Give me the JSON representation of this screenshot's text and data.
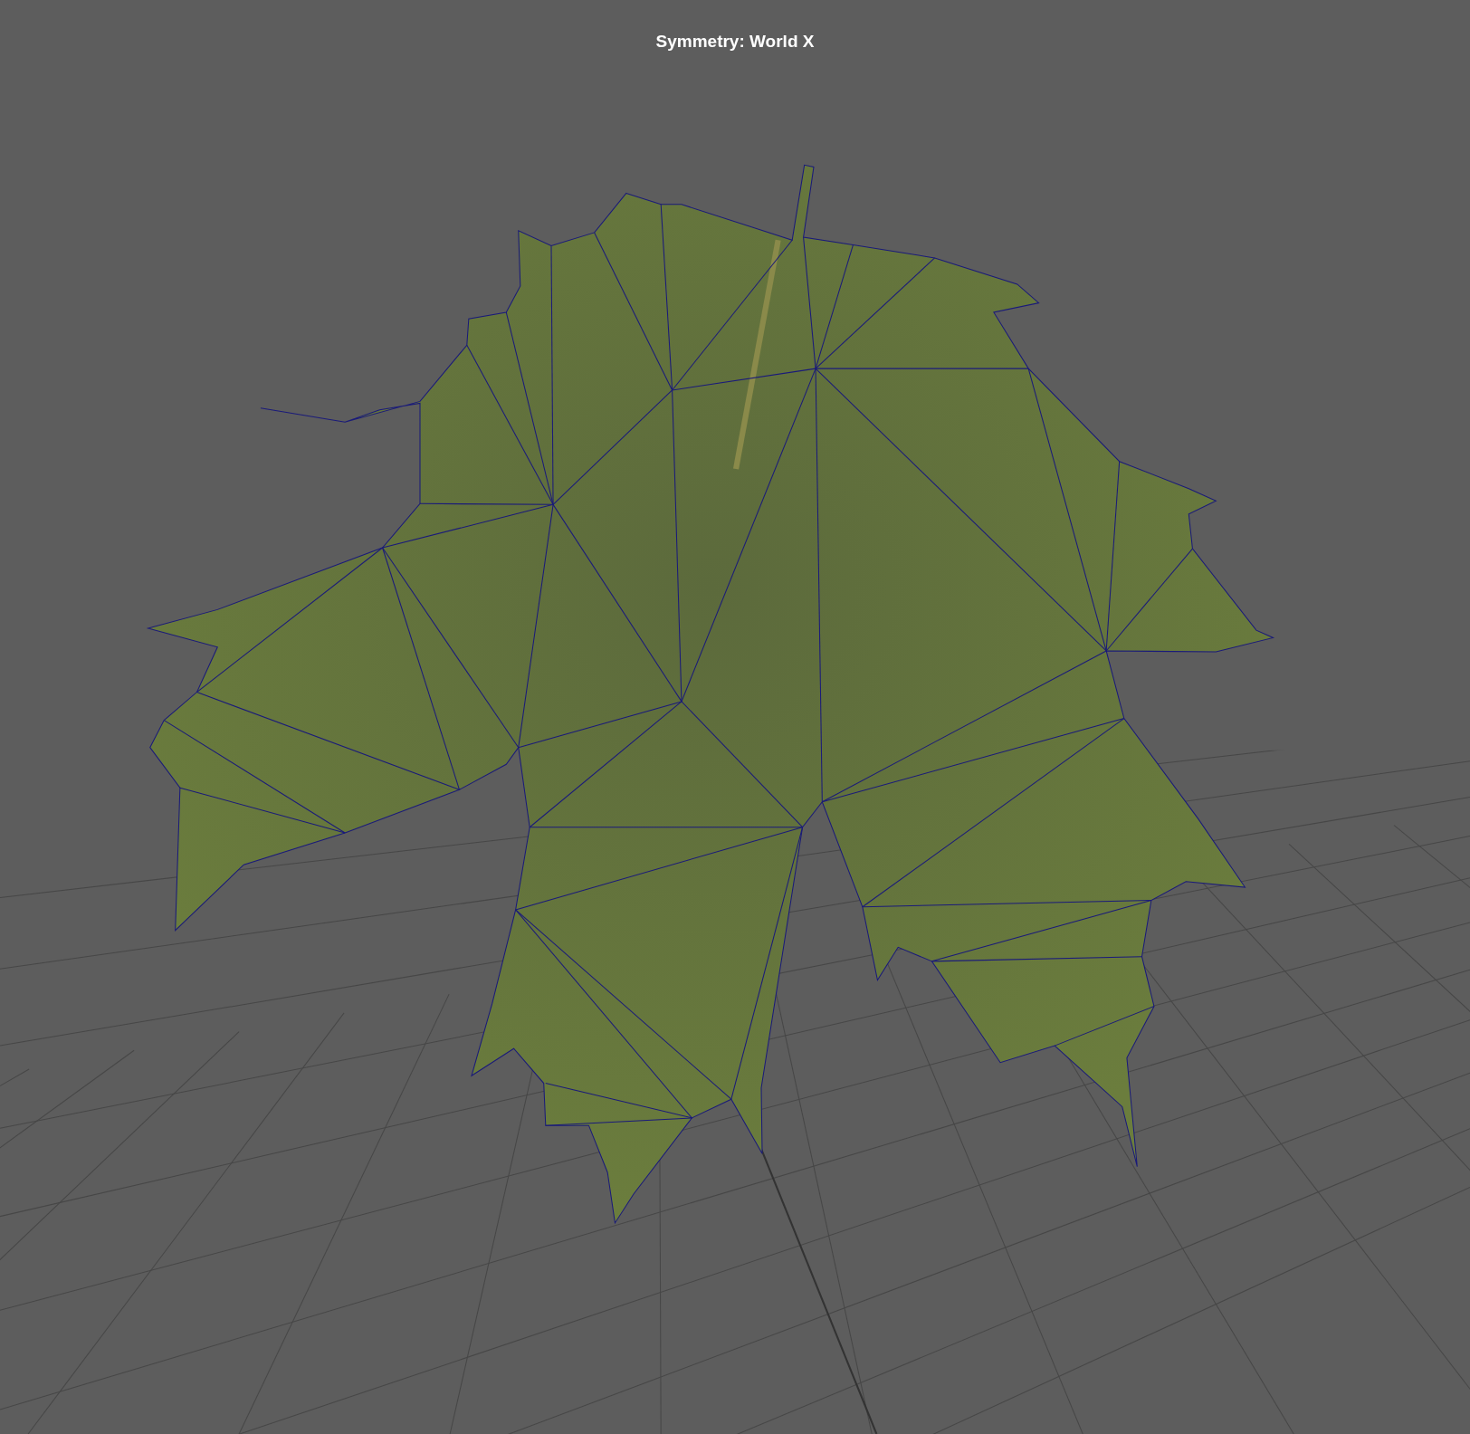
{
  "viewport": {
    "heading": "Symmetry: World X"
  }
}
